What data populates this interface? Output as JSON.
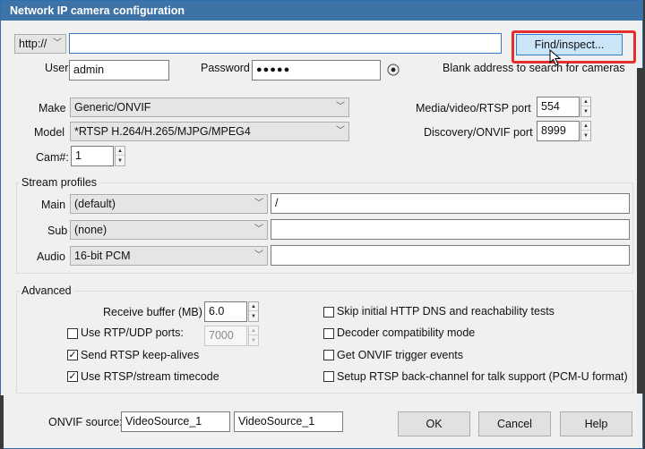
{
  "window": {
    "title": "Network IP camera configuration"
  },
  "address": {
    "protocol": "http://",
    "value": "",
    "find_label": "Find/inspect...",
    "hint": "Blank address to search for cameras"
  },
  "auth": {
    "user_label": "User",
    "user_value": "admin",
    "password_label": "Password",
    "password_value": "●●●●●"
  },
  "device": {
    "make_label": "Make",
    "make_value": "Generic/ONVIF",
    "model_label": "Model",
    "model_value": "*RTSP H.264/H.265/MJPG/MPEG4",
    "cam_label": "Cam#:",
    "cam_value": "1",
    "rtsp_port_label": "Media/video/RTSP port",
    "rtsp_port_value": "554",
    "onvif_port_label": "Discovery/ONVIF port",
    "onvif_port_value": "8999"
  },
  "stream_profiles": {
    "title": "Stream profiles",
    "main_label": "Main",
    "main_value": "(default)",
    "main_path": "/",
    "sub_label": "Sub",
    "sub_value": "(none)",
    "sub_path": "",
    "audio_label": "Audio",
    "audio_value": "16-bit PCM",
    "audio_path": ""
  },
  "advanced": {
    "title": "Advanced",
    "receive_buffer_label": "Receive buffer (MB)",
    "receive_buffer_value": "6.0",
    "rtp_udp_label": "Use RTP/UDP ports:",
    "rtp_udp_checked": false,
    "rtp_udp_value": "7000",
    "keepalives_label": "Send RTSP keep-alives",
    "keepalives_checked": true,
    "timecode_label": "Use RTSP/stream timecode",
    "timecode_checked": true,
    "skip_dns_label": "Skip initial HTTP DNS and reachability tests",
    "skip_dns_checked": false,
    "decoder_label": "Decoder compatibility mode",
    "decoder_checked": false,
    "onvif_events_label": "Get ONVIF trigger events",
    "onvif_events_checked": false,
    "backchannel_label": "Setup RTSP back-channel for talk support (PCM-U format)",
    "backchannel_checked": false
  },
  "footer": {
    "onvif_source_label": "ONVIF source:",
    "onvif_source_1": "VideoSource_1",
    "onvif_source_2": "VideoSource_1",
    "ok_label": "OK",
    "cancel_label": "Cancel",
    "help_label": "Help"
  },
  "colors": {
    "title_bar": "#3d73a6",
    "highlight": "#e53030",
    "find_button": "#cce4f7"
  },
  "icons": {
    "password_reveal": "eye-icon",
    "cursor": "mouse-pointer-icon"
  }
}
